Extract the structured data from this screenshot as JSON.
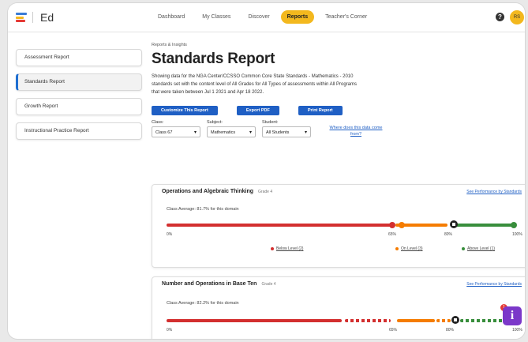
{
  "colors": {
    "accent": "#f3b81e",
    "primary": "#1f5fc4",
    "below": "#d32f2f",
    "on": "#f57c00",
    "above": "#388e3c",
    "help": "#7b38c9"
  },
  "header": {
    "logo_text": "Ed",
    "nav": [
      "Dashboard",
      "My Classes",
      "Discover",
      "Reports",
      "Teacher's Corner"
    ],
    "active_nav": "Reports",
    "help_icon": "?",
    "avatar_initials": "RS"
  },
  "sidebar": {
    "items": [
      "Assessment Report",
      "Standards Report",
      "Growth Report",
      "Instructional Practice Report"
    ],
    "active": "Standards Report"
  },
  "main": {
    "breadcrumb": "Reports & Insights",
    "title": "Standards Report",
    "description": "Showing data for the NGA Center/CCSSO Common Core State Standards - Mathematics - 2010 standards set with the content level of All Grades for All Types of assessments within All Programs that were taken between Jul 1 2021 and Apr 18 2022.",
    "buttons": {
      "customize": "Customize This Report",
      "export": "Export PDF",
      "print": "Print Report"
    },
    "filters": {
      "class_label": "Class:",
      "class_value": "Class 67",
      "subject_label": "Subject:",
      "subject_value": "Mathematics",
      "student_label": "Student:",
      "student_value": "All Students",
      "data_link": "Where does this data come from?"
    }
  },
  "domains": [
    {
      "name": "Operations and Algebraic Thinking",
      "grade": "Grade 4",
      "link": "See Performance by Standards",
      "average_text": "Class Average: 81.7% for this domain",
      "class_average": 81.7,
      "ticks": [
        "0%",
        "65%",
        "80%",
        "100%"
      ],
      "legend": [
        "Below Level (2)",
        "On Level (3)",
        "Above Level (1)"
      ]
    },
    {
      "name": "Number and Operations in Base Ten",
      "grade": "Grade 4",
      "link": "See Performance by Standards",
      "average_text": "Class Average: 82.2% for this domain",
      "class_average": 82.2,
      "ticks": [
        "0%",
        "65%",
        "80%",
        "100%"
      ]
    }
  ],
  "help_fab": {
    "label": "i",
    "badge": "1"
  }
}
